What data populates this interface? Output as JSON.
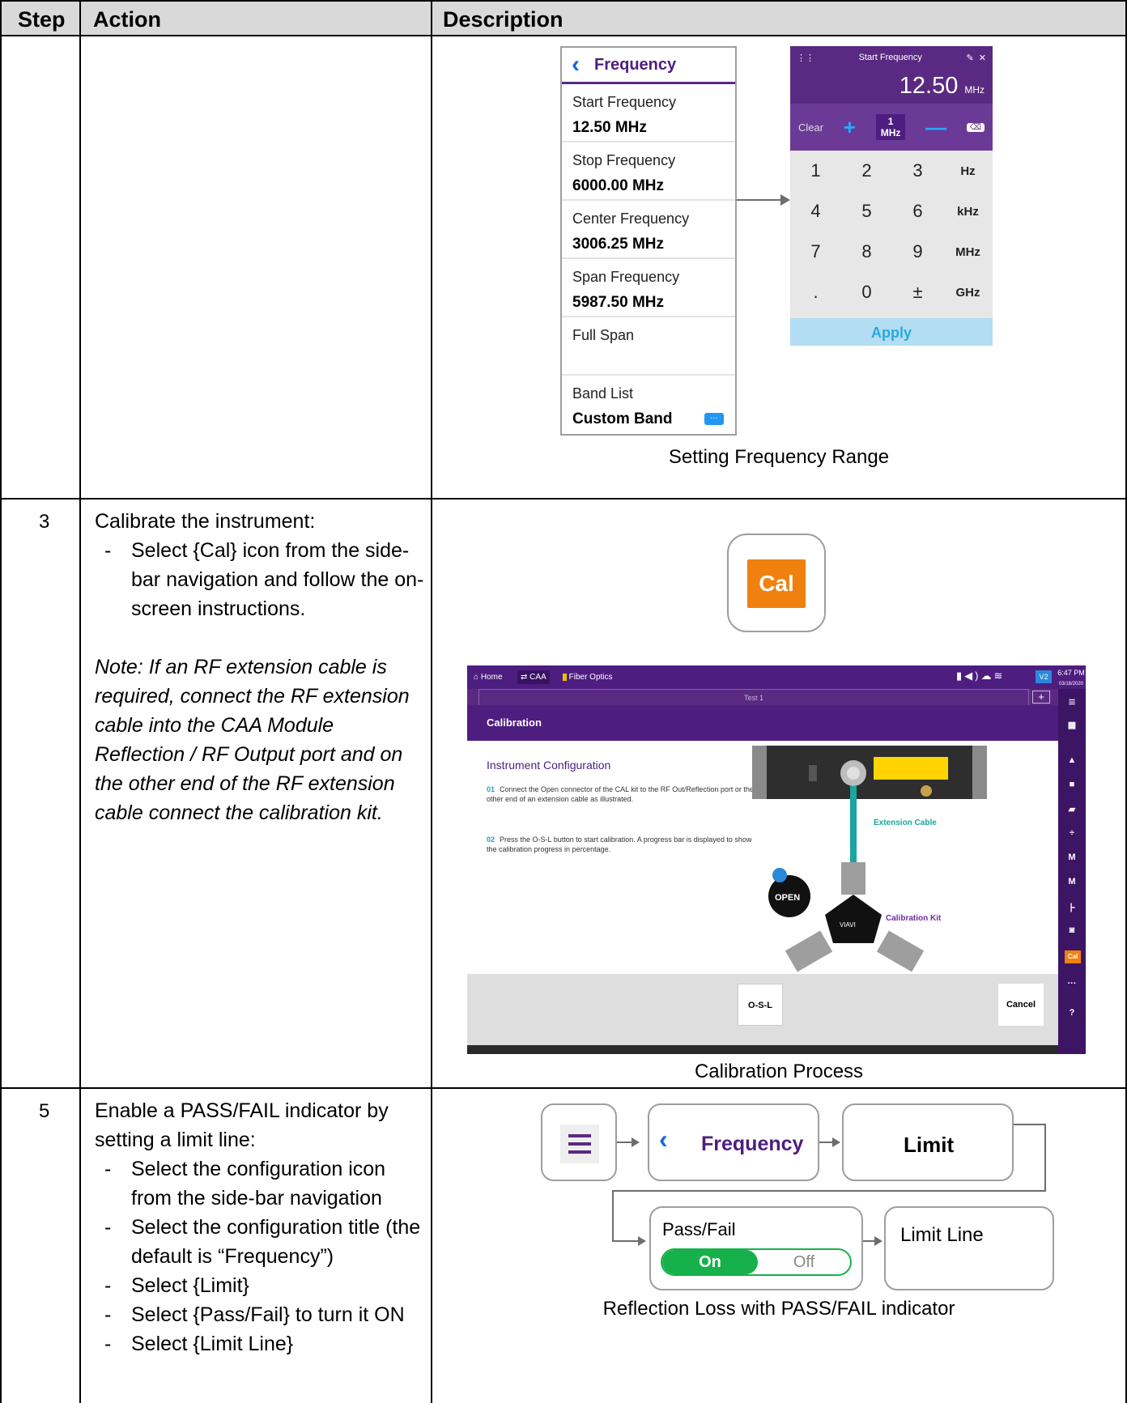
{
  "table": {
    "headers": {
      "step": "Step",
      "action": "Action",
      "description": "Description"
    },
    "rows": [
      {
        "step": "",
        "caption": "Setting Frequency Range"
      },
      {
        "step": "3",
        "intro": "Calibrate the instrument:",
        "bullets": [
          "Select {Cal} icon from the side-bar navigation and follow the on-screen instructions."
        ],
        "note": "Note: If an RF extension cable is required, connect the RF extension cable into the CAA Module Reflection / RF Output port and on the other end of the RF extension cable connect the calibration kit.",
        "caption": "Calibration Process"
      },
      {
        "step": "5",
        "intro": "Enable a PASS/FAIL indicator by setting a limit line:",
        "bullets": [
          "Select the configuration icon from the side-bar navigation",
          "Select the configuration title (the default is “Frequency”)",
          "Select {Limit}",
          "Select {Pass/Fail} to turn it ON",
          "Select {Limit Line}"
        ],
        "caption": "Reflection Loss with PASS/FAIL indicator"
      }
    ]
  },
  "frequency_panel": {
    "title": "Frequency",
    "items": [
      {
        "label": "Start Frequency",
        "value": "12.50 MHz"
      },
      {
        "label": "Stop Frequency",
        "value": "6000.00 MHz"
      },
      {
        "label": "Center Frequency",
        "value": "3006.25 MHz"
      },
      {
        "label": "Span Frequency",
        "value": "5987.50 MHz"
      },
      {
        "label": "Full Span",
        "value": ""
      },
      {
        "label": "Band List",
        "value": "Custom Band"
      }
    ],
    "band_icon": "···"
  },
  "keypad": {
    "title": "Start Frequency",
    "value": "12.50",
    "unit": "MHz",
    "clear": "Clear",
    "plus": "+",
    "minus": "—",
    "step_top": "1",
    "step_bottom": "MHz",
    "keys": [
      "1",
      "2",
      "3",
      "Hz",
      "4",
      "5",
      "6",
      "kHz",
      "7",
      "8",
      "9",
      "MHz",
      ".",
      "0",
      "±",
      "GHz"
    ],
    "apply": "Apply"
  },
  "cal_icon": {
    "label": "Cal"
  },
  "calibration_screen": {
    "tabs": [
      "Home",
      "CAA",
      "Fiber Optics"
    ],
    "time": "6:47 PM",
    "date": "03/18/2020",
    "test_tab": "Test 1",
    "title": "Calibration",
    "heading": "Instrument Configuration",
    "steps": [
      {
        "num": "01",
        "text": "Connect the Open connector of the CAL kit to the RF Out/Reflection port or the other end of an extension cable as illustrated."
      },
      {
        "num": "02",
        "text": "Press the O-S-L button to start calibration. A progress bar is displayed to show the calibration progress in percentage."
      }
    ],
    "extension_cable_label": "Extension Cable",
    "calibration_kit_label": "Calibration Kit",
    "open_label": "OPEN",
    "kit_brand": "VIAVI",
    "osl_button": "O-S-L",
    "cancel_button": "Cancel",
    "sidebar_cal": "Cal"
  },
  "flow": {
    "frequency": "Frequency",
    "limit": "Limit",
    "pass_fail": "Pass/Fail",
    "on": "On",
    "off": "Off",
    "limit_line": "Limit Line"
  },
  "colors": {
    "header_bg": "#d9d9d9",
    "purple": "#4e1d80",
    "accent_blue": "#1565e0",
    "cal_orange": "#f0810f",
    "toggle_green": "#16b14b"
  }
}
